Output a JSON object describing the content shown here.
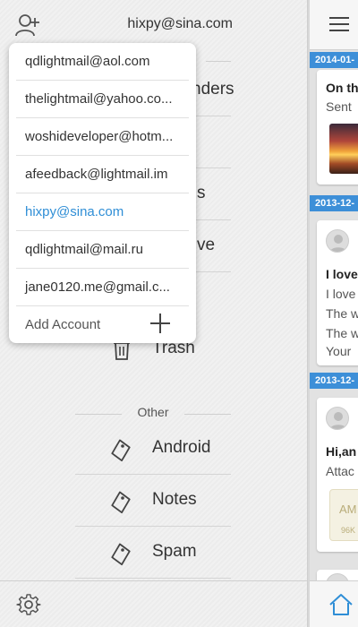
{
  "header": {
    "current_account": "hixpy@sina.com"
  },
  "menu": {
    "items_partial": [
      "nders",
      "s",
      "ve"
    ],
    "trash_label": "Trash",
    "other_section": "Other",
    "labels": [
      {
        "label": "Android",
        "icon": "tag-icon"
      },
      {
        "label": "Notes",
        "icon": "tag-icon"
      },
      {
        "label": "Spam",
        "icon": "tag-icon"
      }
    ]
  },
  "account_dropdown": {
    "accounts": [
      "qdlightmail@aol.com",
      "thelightmail@yahoo.co...",
      "woshideveloper@hotm...",
      "afeedback@lightmail.im",
      "hixpy@sina.com",
      "qdlightmail@mail.ru",
      "jane0120.me@gmail.c..."
    ],
    "active_index": 4,
    "add_account_label": "Add Account"
  },
  "mail_list": {
    "date_headers": [
      "2014-01-",
      "2013-12-",
      "2013-12-"
    ],
    "cards": [
      {
        "lines": [
          "On th",
          "Sent"
        ]
      },
      {
        "lines": [
          "I love",
          "I love",
          "The w",
          "The w",
          "Your"
        ]
      },
      {
        "lines": [
          "Hi,an",
          "Attac"
        ],
        "attachment_ext": "AM",
        "attachment_size": "96K"
      }
    ]
  },
  "colors": {
    "accent": "#2f8ed6",
    "date_bar": "#3d8fd8"
  }
}
